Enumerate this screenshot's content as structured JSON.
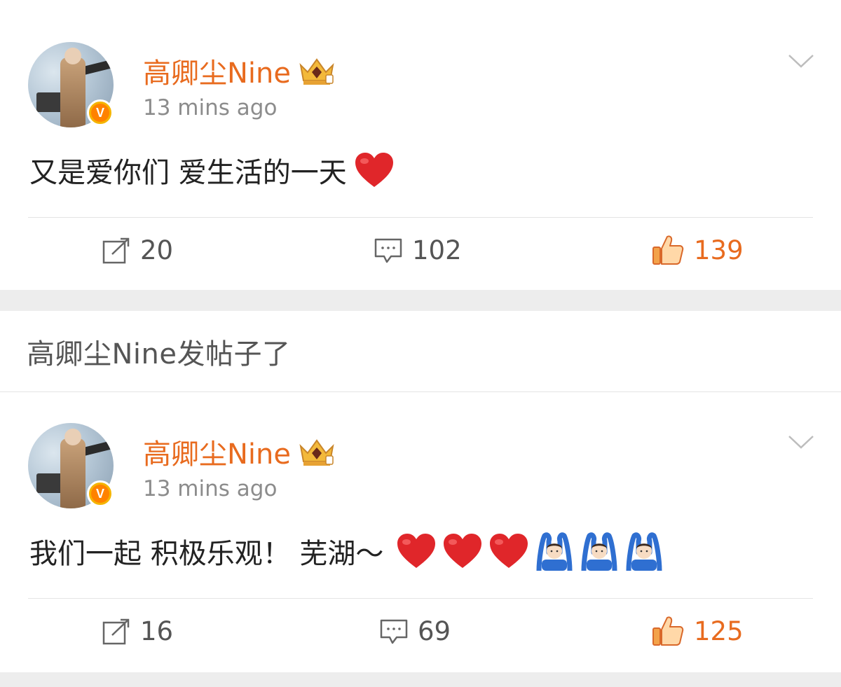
{
  "posts": [
    {
      "username": "高卿尘Nine",
      "timestamp": "13 mins ago",
      "text": "又是爱你们 爱生活的一天",
      "emojis": [
        "heart"
      ],
      "repost_count": "20",
      "comment_count": "102",
      "like_count": "139"
    },
    {
      "username": "高卿尘Nine",
      "timestamp": "13 mins ago",
      "text": "我们一起 积极乐观！ 芜湖～",
      "emojis": [
        "heart",
        "heart",
        "heart",
        "ok-gesture",
        "ok-gesture",
        "ok-gesture"
      ],
      "repost_count": "16",
      "comment_count": "69",
      "like_count": "125"
    }
  ],
  "repost_notice": "高卿尘Nine发帖子了",
  "colors": {
    "username": "#e86b1f",
    "like_count": "#e86b1f",
    "verified_badge": "#ff8200",
    "divider": "#e4e4e4",
    "background": "#ededed"
  },
  "icons": {
    "repost": "repost-icon",
    "comment": "comment-icon",
    "like": "thumbs-up-icon",
    "menu": "chevron-down-icon",
    "member": "crown-icon",
    "verified": "verified-v-icon"
  },
  "badge_letter": "V"
}
